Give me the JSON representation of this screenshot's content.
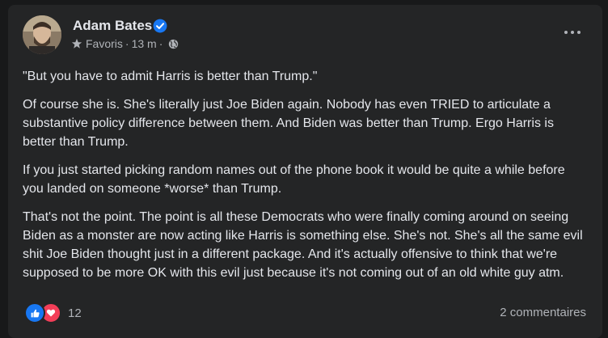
{
  "post": {
    "author": "Adam Bates",
    "meta": {
      "audience": "Favoris",
      "separator": "·",
      "time": "13 m",
      "privacy_icon": "globe-icon"
    },
    "paragraphs": [
      "\"But you have to admit Harris is better than Trump.\"",
      "Of course she is. She's literally just Joe Biden again. Nobody has even TRIED to articulate a substantive policy difference between them. And Biden was better than Trump. Ergo Harris is better than Trump.",
      "If you just started picking random names out of the phone book it would be quite a while before you landed on someone *worse* than Trump.",
      "That's not the point. The point is all these Democrats who were finally coming around on seeing Biden as a monster are now acting like Harris is something else. She's not. She's all the same evil shit Joe Biden thought just in a different package. And it's actually offensive to think that we're supposed to be more OK with this evil just because it's not coming out of an old white guy atm."
    ],
    "reactions": {
      "icons": [
        "like-icon",
        "love-icon"
      ],
      "count": "12"
    },
    "comments_label": "2 commentaires"
  },
  "colors": {
    "background": "#18191a",
    "card": "#242526",
    "primary_text": "#e4e6eb",
    "secondary_text": "#b0b3b8",
    "like_blue": "#1877f2",
    "love_red": "#f33e58"
  }
}
